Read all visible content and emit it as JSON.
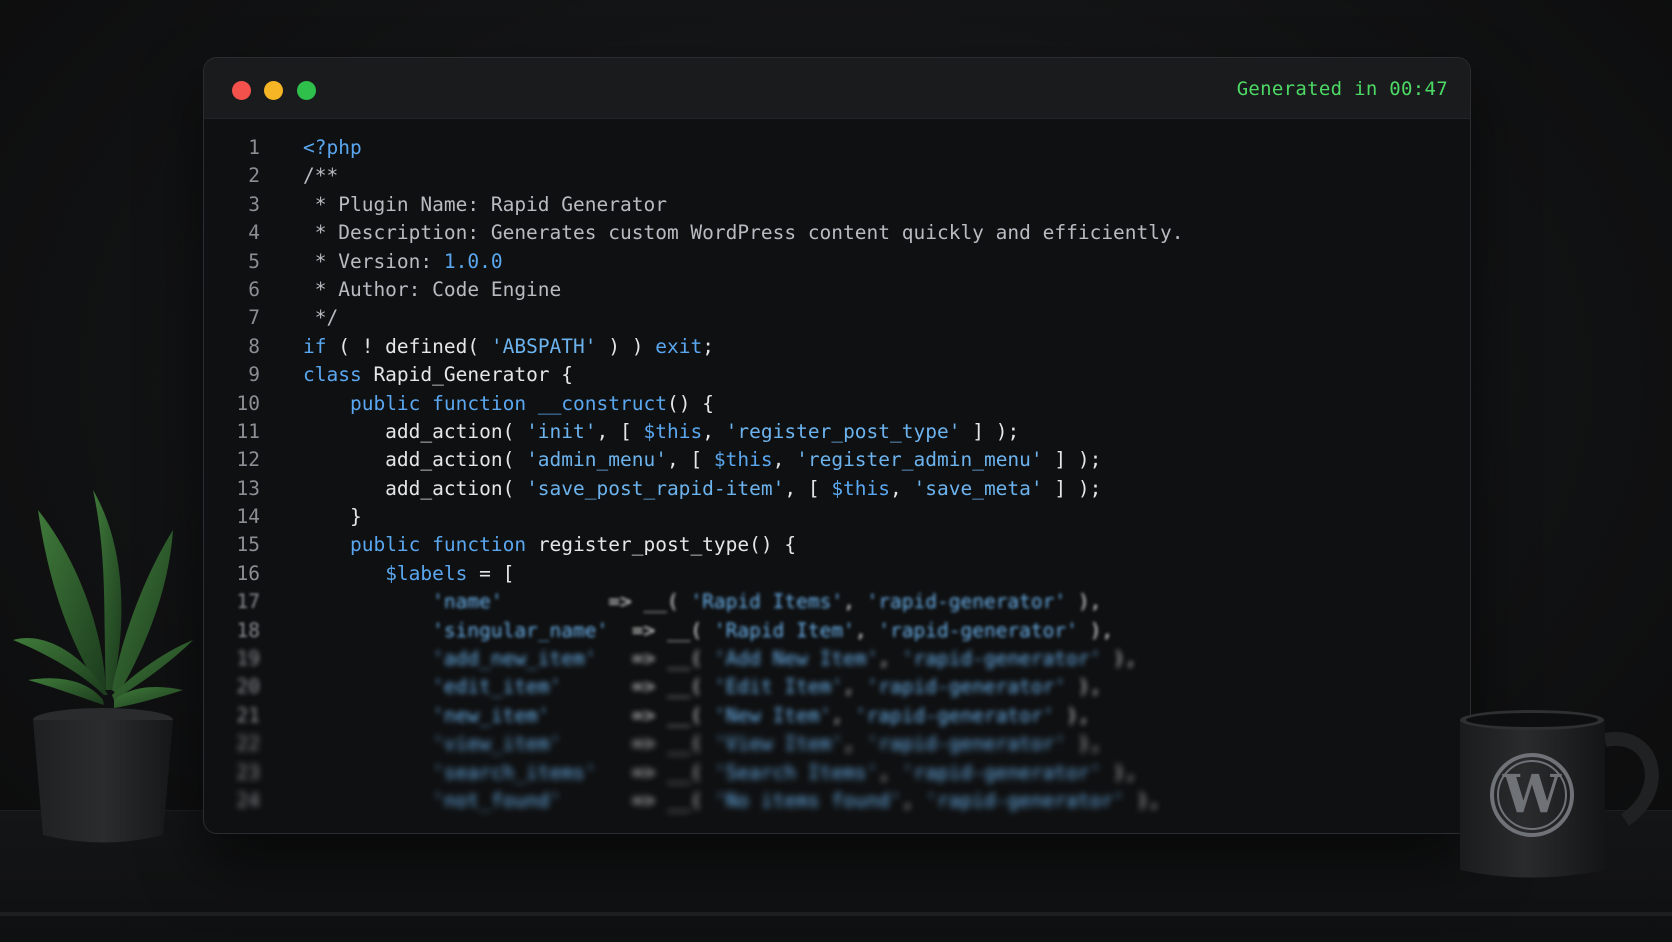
{
  "window": {
    "status": "Generated in 00:47",
    "colors": {
      "close": "#f2514c",
      "minimize": "#f6b525",
      "maximize": "#2fbf4b",
      "status": "#4cd964",
      "keyword": "#5aa7f0"
    }
  },
  "code": {
    "lines": [
      {
        "n": "1",
        "tokens": [
          [
            "kw",
            "<?php"
          ]
        ]
      },
      {
        "n": "2",
        "tokens": [
          [
            "cm",
            "/**"
          ]
        ]
      },
      {
        "n": "3",
        "tokens": [
          [
            "cm",
            " * Plugin Name: Rapid Generator"
          ]
        ]
      },
      {
        "n": "4",
        "tokens": [
          [
            "cm",
            " * Description: Generates custom WordPress content quickly and efficiently."
          ]
        ]
      },
      {
        "n": "5",
        "tokens": [
          [
            "cm",
            " * Version: "
          ],
          [
            "num",
            "1.0.0"
          ]
        ]
      },
      {
        "n": "6",
        "tokens": [
          [
            "cm",
            " * Author: Code Engine"
          ]
        ]
      },
      {
        "n": "7",
        "tokens": [
          [
            "cm",
            " */"
          ]
        ]
      },
      {
        "n": "8",
        "tokens": [
          [
            "kw",
            "if"
          ],
          [
            "pl",
            " ( ! defined( "
          ],
          [
            "str",
            "'ABSPATH'"
          ],
          [
            "pl",
            " ) ) "
          ],
          [
            "kw",
            "exit"
          ],
          [
            "pl",
            ";"
          ]
        ]
      },
      {
        "n": "9",
        "tokens": [
          [
            "kw",
            "class"
          ],
          [
            "pl",
            " Rapid_Generator {"
          ]
        ]
      },
      {
        "n": "10",
        "tokens": [
          [
            "pl",
            "    "
          ],
          [
            "kw",
            "public function"
          ],
          [
            "pl",
            " "
          ],
          [
            "kw",
            "__construct"
          ],
          [
            "pl",
            "() {"
          ]
        ]
      },
      {
        "n": "11",
        "tokens": [
          [
            "pl",
            "       add_action( "
          ],
          [
            "str",
            "'init'"
          ],
          [
            "pl",
            ", [ "
          ],
          [
            "var",
            "$this"
          ],
          [
            "pl",
            ", "
          ],
          [
            "str",
            "'register_post_type'"
          ],
          [
            "pl",
            " ] );"
          ]
        ]
      },
      {
        "n": "12",
        "tokens": [
          [
            "pl",
            "       add_action( "
          ],
          [
            "str",
            "'admin_menu'"
          ],
          [
            "pl",
            ", [ "
          ],
          [
            "var",
            "$this"
          ],
          [
            "pl",
            ", "
          ],
          [
            "str",
            "'register_admin_menu'"
          ],
          [
            "pl",
            " ] );"
          ]
        ]
      },
      {
        "n": "13",
        "tokens": [
          [
            "pl",
            "       add_action( "
          ],
          [
            "str",
            "'save_post_rapid-item'"
          ],
          [
            "pl",
            ", [ "
          ],
          [
            "var",
            "$this"
          ],
          [
            "pl",
            ", "
          ],
          [
            "str",
            "'save_meta'"
          ],
          [
            "pl",
            " ] );"
          ]
        ]
      },
      {
        "n": "14",
        "tokens": [
          [
            "pl",
            "    }"
          ]
        ]
      },
      {
        "n": "15",
        "tokens": [
          [
            "pl",
            "    "
          ],
          [
            "kw",
            "public function"
          ],
          [
            "pl",
            " register_post_type() {"
          ]
        ]
      },
      {
        "n": "16",
        "tokens": [
          [
            "pl",
            "       "
          ],
          [
            "var",
            "$labels"
          ],
          [
            "pl",
            " = ["
          ]
        ]
      },
      {
        "n": "17",
        "tokens": [
          [
            "pl",
            "           "
          ],
          [
            "str",
            "'name'"
          ],
          [
            "pl",
            "         => __( "
          ],
          [
            "str",
            "'Rapid Items'"
          ],
          [
            "pl",
            ", "
          ],
          [
            "str",
            "'rapid-generator'"
          ],
          [
            "pl",
            " ),"
          ]
        ]
      },
      {
        "n": "18",
        "tokens": [
          [
            "pl",
            "           "
          ],
          [
            "str",
            "'singular_name'"
          ],
          [
            "pl",
            "  => __( "
          ],
          [
            "str",
            "'Rapid Item'"
          ],
          [
            "pl",
            ", "
          ],
          [
            "str",
            "'rapid-generator'"
          ],
          [
            "pl",
            " ),"
          ]
        ]
      },
      {
        "n": "19",
        "tokens": [
          [
            "pl",
            "           "
          ],
          [
            "str",
            "'add_new_item'"
          ],
          [
            "pl",
            "   => __( "
          ],
          [
            "str",
            "'Add New Item'"
          ],
          [
            "pl",
            ", "
          ],
          [
            "str",
            "'rapid-generator'"
          ],
          [
            "pl",
            " ),"
          ]
        ]
      },
      {
        "n": "20",
        "tokens": [
          [
            "pl",
            "           "
          ],
          [
            "str",
            "'edit_item'"
          ],
          [
            "pl",
            "      => __( "
          ],
          [
            "str",
            "'Edit Item'"
          ],
          [
            "pl",
            ", "
          ],
          [
            "str",
            "'rapid-generator'"
          ],
          [
            "pl",
            " ),"
          ]
        ]
      },
      {
        "n": "21",
        "tokens": [
          [
            "pl",
            "           "
          ],
          [
            "str",
            "'new_item'"
          ],
          [
            "pl",
            "       => __( "
          ],
          [
            "str",
            "'New Item'"
          ],
          [
            "pl",
            ", "
          ],
          [
            "str",
            "'rapid-generator'"
          ],
          [
            "pl",
            " ),"
          ]
        ]
      },
      {
        "n": "22",
        "tokens": [
          [
            "pl",
            "           "
          ],
          [
            "str",
            "'view_item'"
          ],
          [
            "pl",
            "      => __( "
          ],
          [
            "str",
            "'View Item'"
          ],
          [
            "pl",
            ", "
          ],
          [
            "str",
            "'rapid-generator'"
          ],
          [
            "pl",
            " ),"
          ]
        ]
      },
      {
        "n": "23",
        "tokens": [
          [
            "pl",
            "           "
          ],
          [
            "str",
            "'search_items'"
          ],
          [
            "pl",
            "   => __( "
          ],
          [
            "str",
            "'Search Items'"
          ],
          [
            "pl",
            ", "
          ],
          [
            "str",
            "'rapid-generator'"
          ],
          [
            "pl",
            " ),"
          ]
        ]
      },
      {
        "n": "24",
        "tokens": [
          [
            "pl",
            "           "
          ],
          [
            "str",
            "'not_found'"
          ],
          [
            "pl",
            "      => __( "
          ],
          [
            "str",
            "'No items found'"
          ],
          [
            "pl",
            ", "
          ],
          [
            "str",
            "'rapid-generator'"
          ],
          [
            "pl",
            " ),"
          ]
        ]
      }
    ]
  },
  "mug": {
    "logo": "wordpress-logo"
  }
}
